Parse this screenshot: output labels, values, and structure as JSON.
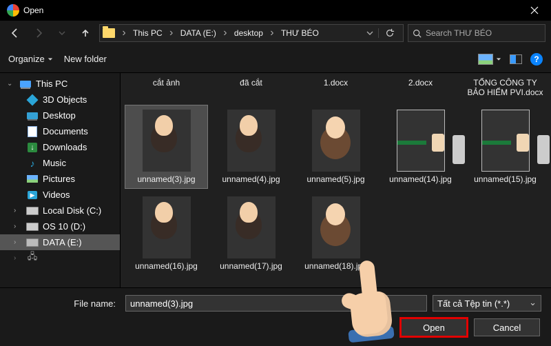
{
  "titlebar": {
    "title": "Open"
  },
  "nav": {
    "crumbs": [
      "This PC",
      "DATA (E:)",
      "desktop",
      "THƯ BÉO"
    ]
  },
  "search": {
    "placeholder": "Search THƯ BÉO"
  },
  "toolbar": {
    "organize": "Organize",
    "newfolder": "New folder"
  },
  "sidebar": {
    "root": "This PC",
    "items": [
      {
        "label": "3D Objects",
        "icon": "3d"
      },
      {
        "label": "Desktop",
        "icon": "desktop"
      },
      {
        "label": "Documents",
        "icon": "doc"
      },
      {
        "label": "Downloads",
        "icon": "dl"
      },
      {
        "label": "Music",
        "icon": "music"
      },
      {
        "label": "Pictures",
        "icon": "pic"
      },
      {
        "label": "Videos",
        "icon": "vid"
      },
      {
        "label": "Local Disk (C:)",
        "icon": "drive"
      },
      {
        "label": "OS 10 (D:)",
        "icon": "drive"
      },
      {
        "label": "DATA (E:)",
        "icon": "drive",
        "selected": true
      }
    ]
  },
  "files_row1": [
    {
      "name": "cắt ảnh",
      "type": "label"
    },
    {
      "name": "đã cắt",
      "type": "label"
    },
    {
      "name": "1.docx",
      "type": "label"
    },
    {
      "name": "2.docx",
      "type": "label"
    },
    {
      "name": "TỔNG CÔNG TY BẢO HIỂM PVI.docx",
      "type": "label"
    }
  ],
  "files_row2": [
    {
      "name": "unnamed(3).jpg",
      "thumb": "photo",
      "selected": true
    },
    {
      "name": "unnamed(4).jpg",
      "thumb": "photo"
    },
    {
      "name": "unnamed(5).jpg",
      "thumb": "selfie"
    },
    {
      "name": "unnamed(14).jpg",
      "thumb": "card"
    },
    {
      "name": "unnamed(15).jpg",
      "thumb": "card"
    }
  ],
  "files_row3": [
    {
      "name": "unnamed(16).jpg",
      "thumb": "photo"
    },
    {
      "name": "unnamed(17).jpg",
      "thumb": "photo"
    },
    {
      "name": "unnamed(18).jpg",
      "thumb": "selfie"
    }
  ],
  "bottom": {
    "filename_label": "File name:",
    "filename_value": "unnamed(3).jpg",
    "filter": "Tất cả Tệp tin (*.*)",
    "open": "Open",
    "cancel": "Cancel"
  }
}
